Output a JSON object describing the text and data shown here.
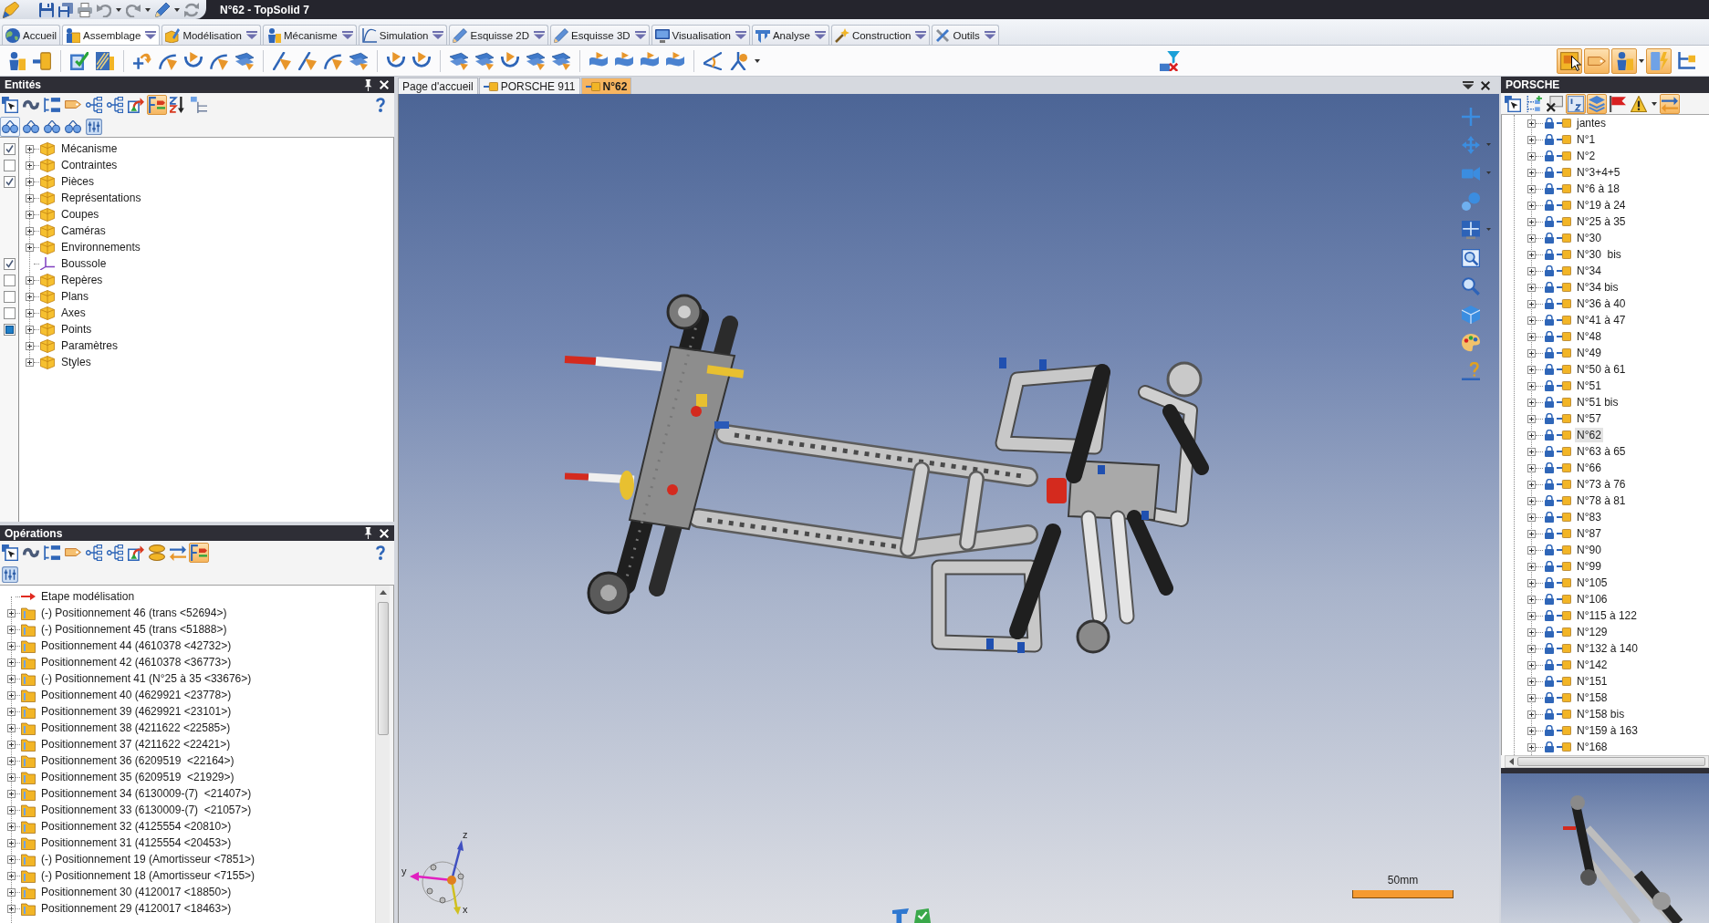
{
  "window": {
    "title": "N°62 - TopSolid 7"
  },
  "ribbon": {
    "tabs": [
      {
        "label": "Accueil",
        "selected": false,
        "dropdown": false
      },
      {
        "label": "Assemblage",
        "selected": true,
        "dropdown": true
      },
      {
        "label": "Modélisation",
        "selected": false,
        "dropdown": true
      },
      {
        "label": "Mécanisme",
        "selected": false,
        "dropdown": true
      },
      {
        "label": "Simulation",
        "selected": false,
        "dropdown": true
      },
      {
        "label": "Esquisse 2D",
        "selected": false,
        "dropdown": true
      },
      {
        "label": "Esquisse 3D",
        "selected": false,
        "dropdown": true
      },
      {
        "label": "Visualisation",
        "selected": false,
        "dropdown": true
      },
      {
        "label": "Analyse",
        "selected": false,
        "dropdown": true
      },
      {
        "label": "Construction",
        "selected": false,
        "dropdown": true
      },
      {
        "label": "Outils",
        "selected": false,
        "dropdown": true
      }
    ]
  },
  "toolbar": {
    "view_toggles": [
      {
        "on": true
      },
      {
        "on": true
      },
      {
        "on": true
      },
      {
        "on": true
      },
      {
        "on": false
      }
    ]
  },
  "entities_panel": {
    "title": "Entités",
    "toolbar": [
      {
        "on": false
      },
      {
        "on": false
      },
      {
        "on": false
      },
      {
        "on": false
      },
      {
        "on": false
      },
      {
        "on": false
      },
      {
        "on": false
      },
      {
        "on": true
      },
      {
        "on": false
      },
      {
        "on": false
      }
    ],
    "filters": [
      {
        "on": true
      },
      {
        "on": false
      },
      {
        "on": false
      },
      {
        "on": false
      },
      {
        "on": false
      }
    ],
    "tree": [
      {
        "label": "Mécanisme",
        "kind": "folder",
        "expanded": false,
        "checked": true,
        "indeterminate": false
      },
      {
        "label": "Contraintes",
        "kind": "folder",
        "expanded": false,
        "checked": false,
        "indeterminate": false
      },
      {
        "label": "Pièces",
        "kind": "folder",
        "expanded": false,
        "checked": true,
        "indeterminate": false
      },
      {
        "label": "Représentations",
        "kind": "folder",
        "expanded": false
      },
      {
        "label": "Coupes",
        "kind": "folder",
        "expanded": false
      },
      {
        "label": "Caméras",
        "kind": "folder",
        "expanded": false
      },
      {
        "label": "Environnements",
        "kind": "folder",
        "expanded": false
      },
      {
        "label": "Boussole",
        "kind": "compass",
        "checked": true,
        "indeterminate": false
      },
      {
        "label": "Repères",
        "kind": "folder",
        "expanded": false,
        "checked": false,
        "indeterminate": false
      },
      {
        "label": "Plans",
        "kind": "folder",
        "expanded": false,
        "checked": false,
        "indeterminate": false
      },
      {
        "label": "Axes",
        "kind": "folder",
        "expanded": false,
        "checked": false,
        "indeterminate": false
      },
      {
        "label": "Points",
        "kind": "folder",
        "expanded": false,
        "checked": false,
        "indeterminate": true
      },
      {
        "label": "Paramètres",
        "kind": "folder",
        "expanded": false
      },
      {
        "label": "Styles",
        "kind": "folder",
        "expanded": false
      }
    ]
  },
  "operations_panel": {
    "title": "Opérations",
    "toolbar": [
      {
        "on": false
      },
      {
        "on": false
      },
      {
        "on": false
      },
      {
        "on": false
      },
      {
        "on": false
      },
      {
        "on": false
      },
      {
        "on": false
      },
      {
        "on": false
      },
      {
        "on": false
      },
      {
        "on": true
      }
    ],
    "filters": [
      {
        "on": false
      }
    ],
    "tree": [
      {
        "label": "Etape modélisation",
        "kind": "step"
      },
      {
        "label": "(-) Positionnement 46 (trans <52694>)",
        "kind": "positioning",
        "expanded": false
      },
      {
        "label": "(-) Positionnement 45 (trans <51888>)",
        "kind": "positioning",
        "expanded": false
      },
      {
        "label": "Positionnement 44 (4610378 <42732>)",
        "kind": "positioning",
        "expanded": false
      },
      {
        "label": "Positionnement 42 (4610378 <36773>)",
        "kind": "positioning",
        "expanded": false
      },
      {
        "label": "(-) Positionnement 41 (N°25 à 35 <33676>)",
        "kind": "positioning",
        "expanded": false
      },
      {
        "label": "Positionnement 40 (4629921 <23778>)",
        "kind": "positioning",
        "expanded": false
      },
      {
        "label": "Positionnement 39 (4629921 <23101>)",
        "kind": "positioning",
        "expanded": false
      },
      {
        "label": "Positionnement 38 (4211622 <22585>)",
        "kind": "positioning",
        "expanded": false
      },
      {
        "label": "Positionnement 37 (4211622 <22421>)",
        "kind": "positioning",
        "expanded": false
      },
      {
        "label": "Positionnement 36 (6209519  <22164>)",
        "kind": "positioning",
        "expanded": false
      },
      {
        "label": "Positionnement 35 (6209519  <21929>)",
        "kind": "positioning",
        "expanded": false
      },
      {
        "label": "Positionnement 34 (6130009-(7)  <21407>)",
        "kind": "positioning",
        "expanded": false
      },
      {
        "label": "Positionnement 33 (6130009-(7)  <21057>)",
        "kind": "positioning",
        "expanded": false
      },
      {
        "label": "Positionnement 32 (4125554 <20810>)",
        "kind": "positioning",
        "expanded": false
      },
      {
        "label": "Positionnement 31 (4125554 <20453>)",
        "kind": "positioning",
        "expanded": false
      },
      {
        "label": "(-) Positionnement 19 (Amortisseur <7851>)",
        "kind": "positioning",
        "expanded": false
      },
      {
        "label": "(-) Positionnement 18 (Amortisseur <7155>)",
        "kind": "positioning",
        "expanded": false
      },
      {
        "label": "Positionnement 30 (4120017 <18850>)",
        "kind": "positioning",
        "expanded": false
      },
      {
        "label": "Positionnement 29 (4120017 <18463>)",
        "kind": "positioning",
        "expanded": false
      }
    ]
  },
  "viewport": {
    "tabs": [
      {
        "label": "Page d'accueil",
        "kind": "home",
        "selected": false
      },
      {
        "label": "PORSCHE 911",
        "kind": "assembly",
        "selected": false
      },
      {
        "label": "N°62",
        "kind": "part",
        "selected": true
      }
    ],
    "axis_labels": [
      "z",
      "y",
      "x"
    ],
    "scale_label": "50mm"
  },
  "document_panel": {
    "title": "PORSCHE",
    "toolbar": [
      {
        "on": false
      },
      {
        "on": false
      },
      {
        "on": false
      },
      {
        "on": true
      },
      {
        "on": true
      },
      {
        "on": false
      },
      {
        "on": false
      },
      {
        "on": true
      }
    ],
    "tree": [
      {
        "label": "jantes",
        "expanded": false,
        "selected": false
      },
      {
        "label": "N°1",
        "expanded": false,
        "selected": false
      },
      {
        "label": "N°2",
        "expanded": false,
        "selected": false
      },
      {
        "label": "N°3+4+5",
        "expanded": false,
        "selected": false
      },
      {
        "label": "N°6 à 18",
        "expanded": false,
        "selected": false
      },
      {
        "label": "N°19 à 24",
        "expanded": false,
        "selected": false
      },
      {
        "label": "N°25 à 35",
        "expanded": false,
        "selected": false
      },
      {
        "label": "N°30",
        "expanded": false,
        "selected": false
      },
      {
        "label": "N°30  bis",
        "expanded": false,
        "selected": false
      },
      {
        "label": "N°34",
        "expanded": false,
        "selected": false
      },
      {
        "label": "N°34 bis",
        "expanded": false,
        "selected": false
      },
      {
        "label": "N°36 à 40",
        "expanded": false,
        "selected": false
      },
      {
        "label": "N°41 à 47",
        "expanded": false,
        "selected": false
      },
      {
        "label": "N°48",
        "expanded": false,
        "selected": false
      },
      {
        "label": "N°49",
        "expanded": false,
        "selected": false
      },
      {
        "label": "N°50 à 61",
        "expanded": false,
        "selected": false
      },
      {
        "label": "N°51",
        "expanded": false,
        "selected": false
      },
      {
        "label": "N°51 bis",
        "expanded": false,
        "selected": false
      },
      {
        "label": "N°57",
        "expanded": false,
        "selected": false
      },
      {
        "label": "N°62",
        "expanded": false,
        "selected": true
      },
      {
        "label": "N°63 à 65",
        "expanded": false,
        "selected": false
      },
      {
        "label": "N°66",
        "expanded": false,
        "selected": false
      },
      {
        "label": "N°73 à 76",
        "expanded": false,
        "selected": false
      },
      {
        "label": "N°78 à 81",
        "expanded": false,
        "selected": false
      },
      {
        "label": "N°83",
        "expanded": false,
        "selected": false
      },
      {
        "label": "N°87",
        "expanded": false,
        "selected": false
      },
      {
        "label": "N°90",
        "expanded": false,
        "selected": false
      },
      {
        "label": "N°99",
        "expanded": false,
        "selected": false
      },
      {
        "label": "N°105",
        "expanded": false,
        "selected": false
      },
      {
        "label": "N°106",
        "expanded": false,
        "selected": false
      },
      {
        "label": "N°115 à 122",
        "expanded": false,
        "selected": false
      },
      {
        "label": "N°129",
        "expanded": false,
        "selected": false
      },
      {
        "label": "N°132 à 140",
        "expanded": false,
        "selected": false
      },
      {
        "label": "N°142",
        "expanded": false,
        "selected": false
      },
      {
        "label": "N°151",
        "expanded": false,
        "selected": false
      },
      {
        "label": "N°158",
        "expanded": false,
        "selected": false
      },
      {
        "label": "N°158 bis",
        "expanded": false,
        "selected": false
      },
      {
        "label": "N°159 à 163",
        "expanded": false,
        "selected": false
      },
      {
        "label": "N°168",
        "expanded": false,
        "selected": false
      }
    ]
  }
}
